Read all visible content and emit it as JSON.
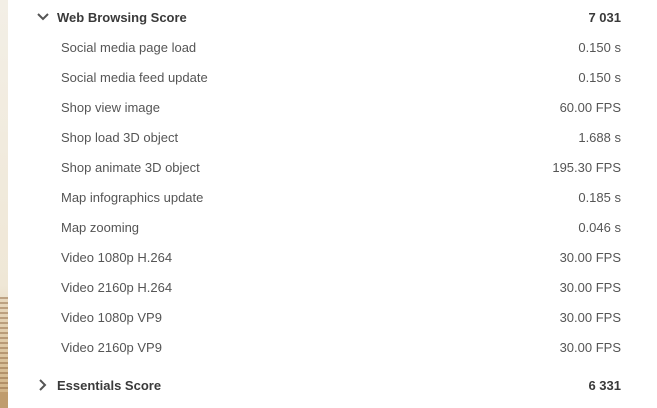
{
  "sections": [
    {
      "title": "Web Browsing Score",
      "score": "7 031",
      "expanded": true,
      "icon": "chevron-down-icon",
      "items": [
        {
          "label": "Social media page load",
          "value": "0.150 s"
        },
        {
          "label": "Social media feed update",
          "value": "0.150 s"
        },
        {
          "label": "Shop view image",
          "value": "60.00 FPS"
        },
        {
          "label": "Shop load 3D object",
          "value": "1.688 s"
        },
        {
          "label": "Shop animate 3D object",
          "value": "195.30 FPS"
        },
        {
          "label": "Map infographics update",
          "value": "0.185 s"
        },
        {
          "label": "Map zooming",
          "value": "0.046 s"
        },
        {
          "label": "Video 1080p H.264",
          "value": "30.00 FPS"
        },
        {
          "label": "Video 2160p H.264",
          "value": "30.00 FPS"
        },
        {
          "label": "Video 1080p VP9",
          "value": "30.00 FPS"
        },
        {
          "label": "Video 2160p VP9",
          "value": "30.00 FPS"
        }
      ]
    },
    {
      "title": "Essentials Score",
      "score": "6 331",
      "expanded": false,
      "icon": "chevron-right-icon",
      "items": []
    }
  ]
}
